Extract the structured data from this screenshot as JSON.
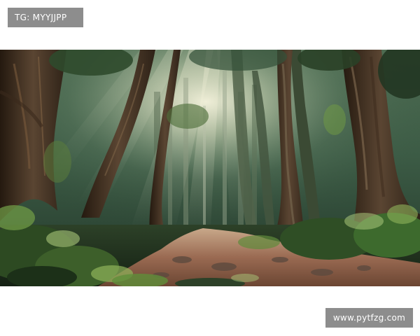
{
  "watermarks": {
    "top_left": "TG: MYYJJPP",
    "bottom_right": "www.pytfzg.com"
  },
  "image": {
    "subject": "forest-path",
    "palette": {
      "canopy_dark": "#1f3324",
      "canopy_mid": "#3f5a3c",
      "light_core": "#f2f1dc",
      "bark_dark": "#2e2217",
      "bark_mid": "#5a4532",
      "path_warm": "#9a6a52",
      "fern_green": "#6f9a45",
      "fern_light": "#a9c77a"
    }
  }
}
